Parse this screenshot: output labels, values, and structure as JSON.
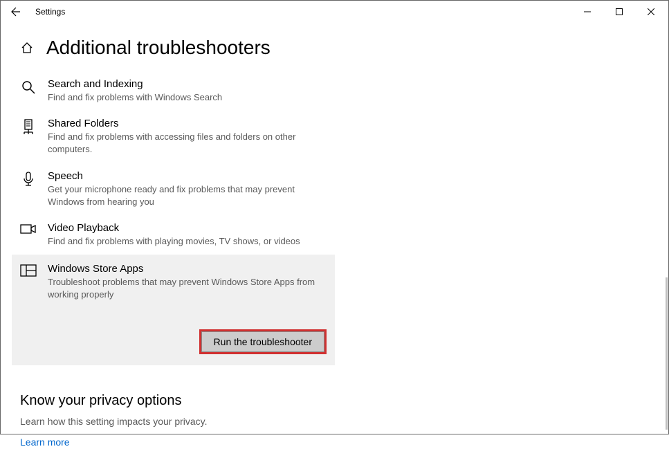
{
  "window": {
    "title": "Settings"
  },
  "page": {
    "title": "Additional troubleshooters"
  },
  "troubleshooters": [
    {
      "icon": "search-icon",
      "title": "Search and Indexing",
      "desc": "Find and fix problems with Windows Search"
    },
    {
      "icon": "shared-folders-icon",
      "title": "Shared Folders",
      "desc": "Find and fix problems with accessing files and folders on other computers."
    },
    {
      "icon": "microphone-icon",
      "title": "Speech",
      "desc": "Get your microphone ready and fix problems that may prevent Windows from hearing you"
    },
    {
      "icon": "video-icon",
      "title": "Video Playback",
      "desc": "Find and fix problems with playing movies, TV shows, or videos"
    },
    {
      "icon": "store-apps-icon",
      "title": "Windows Store Apps",
      "desc": "Troubleshoot problems that may prevent Windows Store Apps from working properly"
    }
  ],
  "run_button": "Run the troubleshooter",
  "privacy": {
    "title": "Know your privacy options",
    "desc": "Learn how this setting impacts your privacy.",
    "link": "Learn more"
  }
}
